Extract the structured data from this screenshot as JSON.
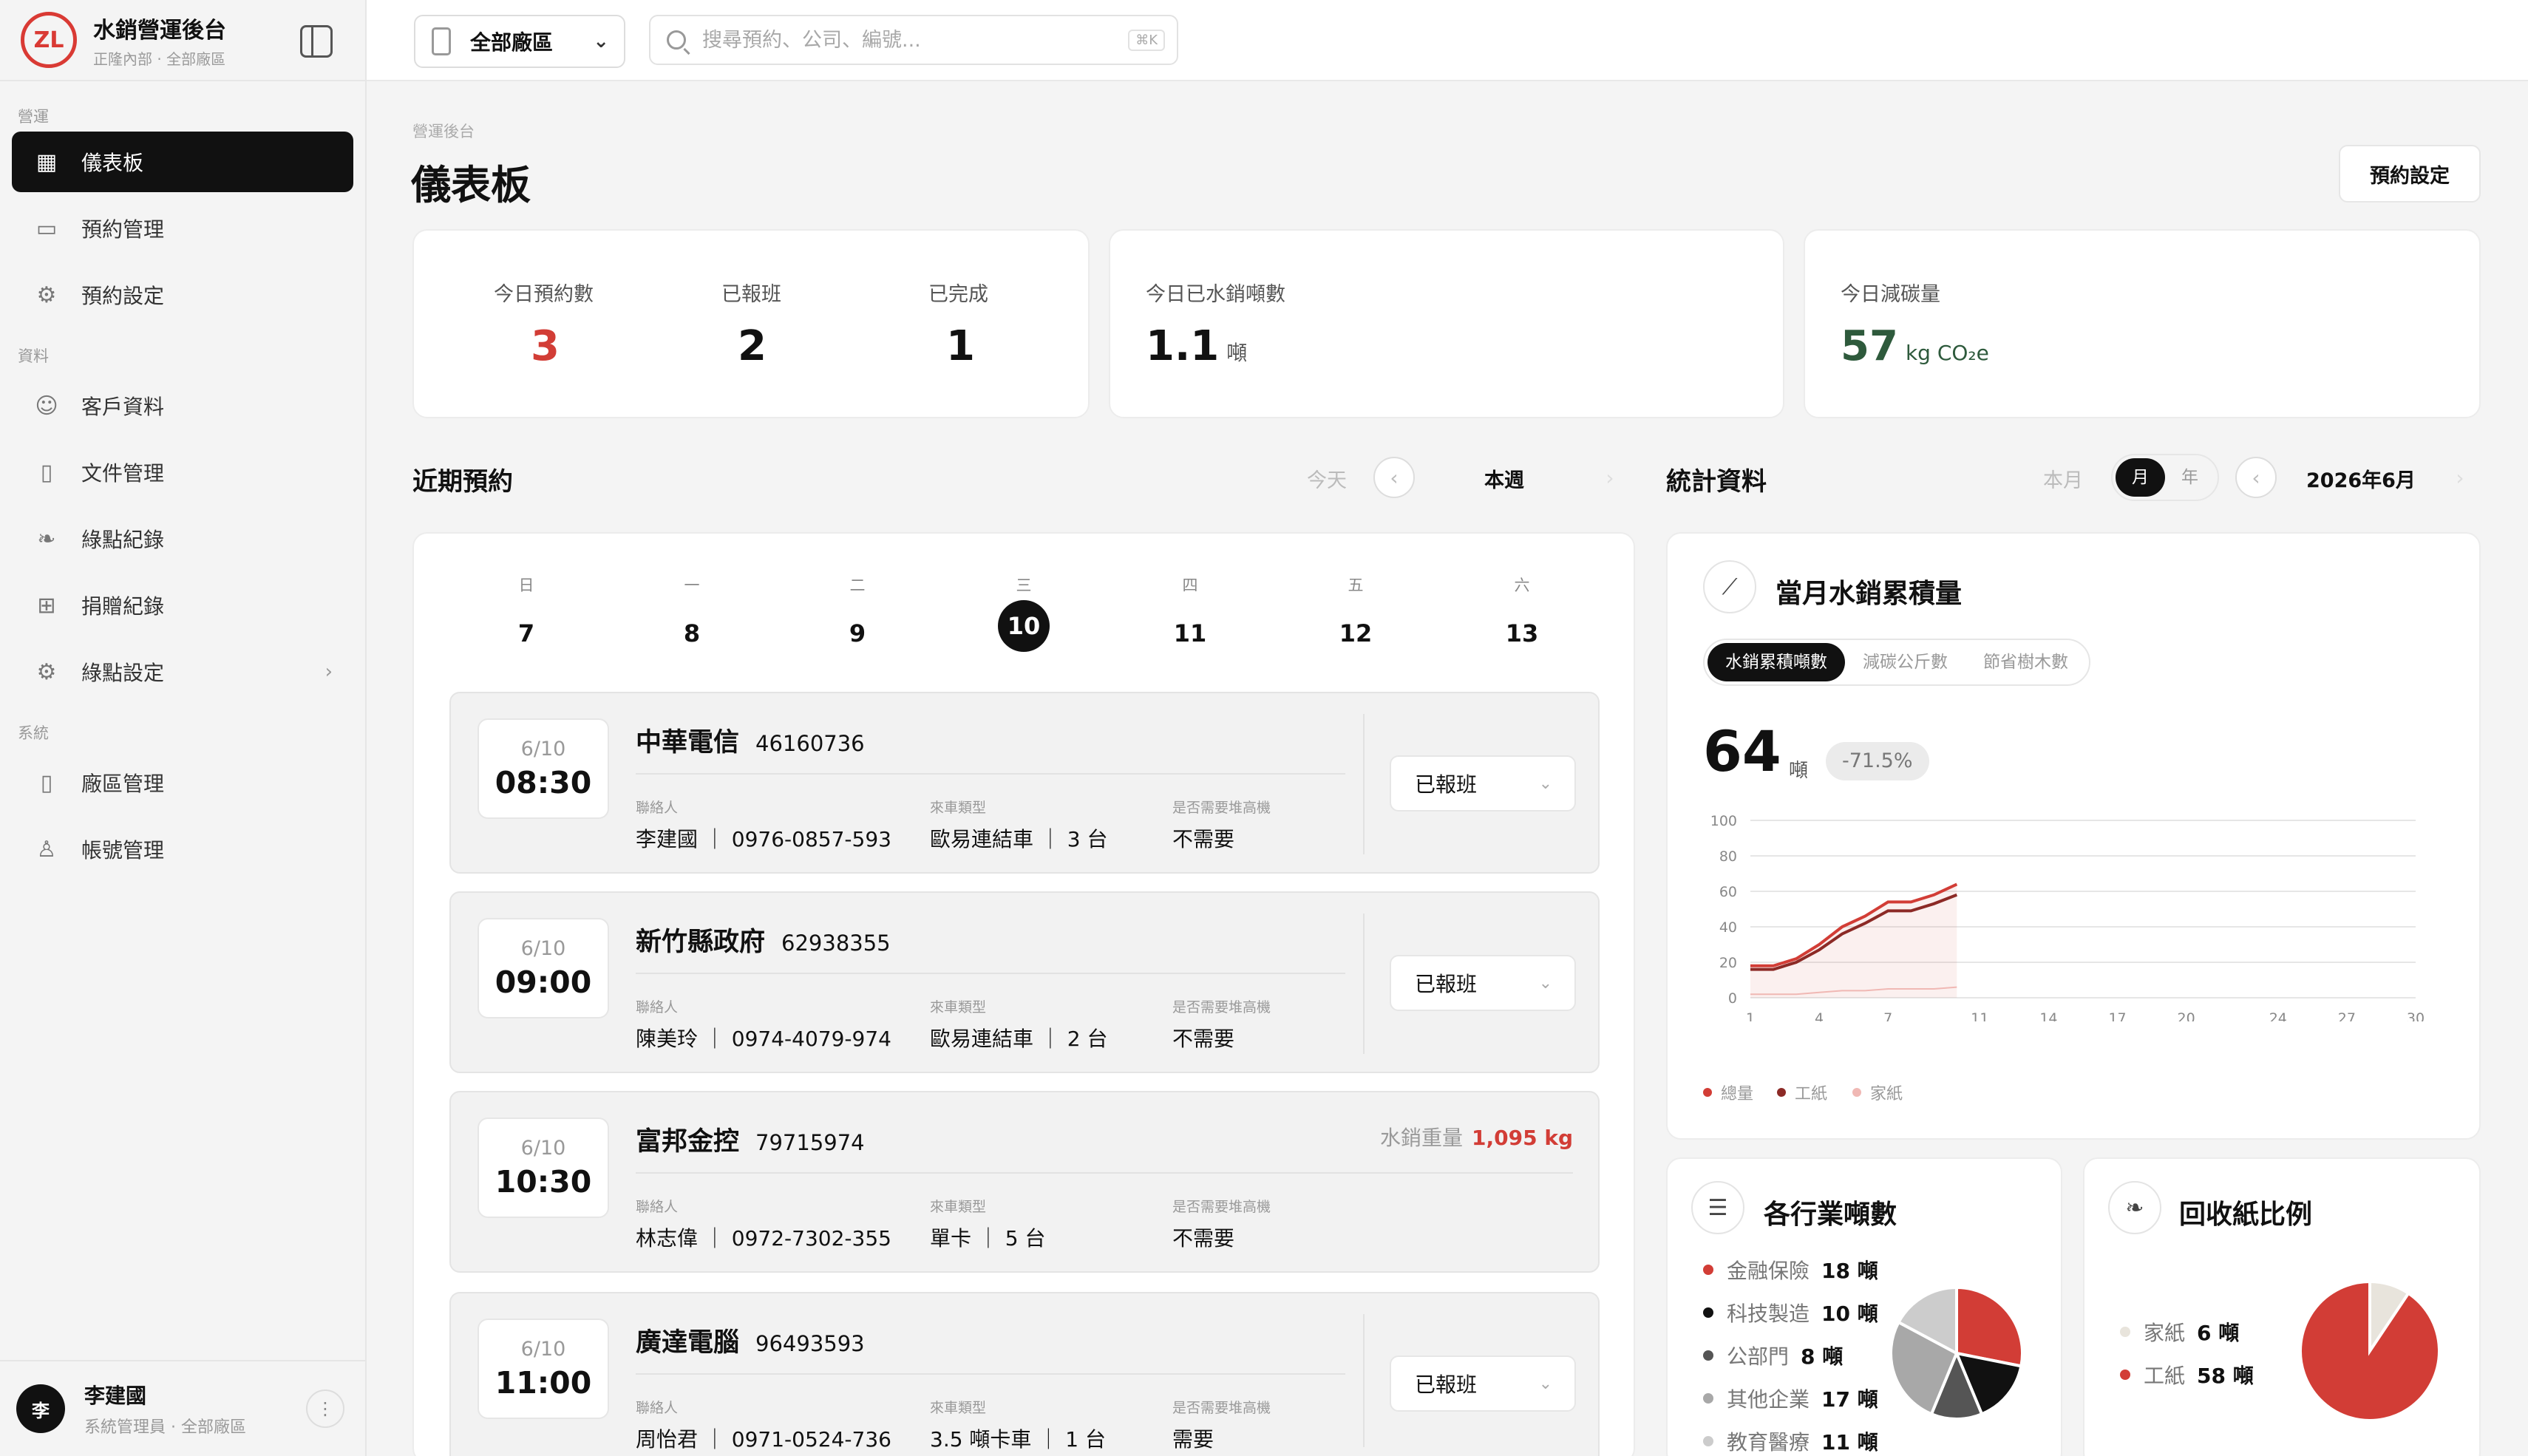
{
  "app": {
    "title": "水銷營運後台",
    "subtitle": "正隆內部 · 全部廠區",
    "logo_text": "ZL"
  },
  "sidebar": {
    "sections": {
      "ops": "營運",
      "data": "資料",
      "system": "系統"
    },
    "items": [
      {
        "label": "儀表板",
        "icon": "grid-icon",
        "active": true
      },
      {
        "label": "預約管理",
        "icon": "calendar-icon"
      },
      {
        "label": "預約設定",
        "icon": "gear-icon"
      },
      {
        "label": "客戶資料",
        "icon": "users-icon"
      },
      {
        "label": "文件管理",
        "icon": "document-icon"
      },
      {
        "label": "綠點紀錄",
        "icon": "leaf-icon"
      },
      {
        "label": "捐贈紀錄",
        "icon": "gift-icon"
      },
      {
        "label": "綠點設定",
        "icon": "gear-icon"
      },
      {
        "label": "廠區管理",
        "icon": "device-icon"
      },
      {
        "label": "帳號管理",
        "icon": "user-icon"
      }
    ],
    "user": {
      "avatar": "李",
      "name": "李建國",
      "role": "系統管理員 · 全部廠區"
    }
  },
  "topbar": {
    "factory_select": "全部廠區",
    "search_placeholder": "搜尋預約、公司、編號...",
    "search_shortcut": "⌘K"
  },
  "page": {
    "breadcrumb": "營運後台",
    "title": "儀表板",
    "settings_button": "預約設定"
  },
  "kpis": {
    "today_reservations": {
      "label": "今日預約數",
      "value": "3",
      "color": "#d23d36"
    },
    "checked_in": {
      "label": "已報班",
      "value": "2"
    },
    "completed": {
      "label": "已完成",
      "value": "1"
    },
    "tons_today": {
      "label": "今日已水銷噸數",
      "value": "1.1",
      "unit": "噸"
    },
    "carbon_today": {
      "label": "今日減碳量",
      "value": "57",
      "unit": "kg CO₂e",
      "color": "#2e5a3c"
    }
  },
  "recent": {
    "title": "近期預約",
    "today_btn": "今天",
    "range_label": "本週",
    "days": [
      {
        "name": "日",
        "num": "7"
      },
      {
        "name": "一",
        "num": "8"
      },
      {
        "name": "二",
        "num": "9"
      },
      {
        "name": "三",
        "num": "10",
        "selected": true
      },
      {
        "name": "四",
        "num": "11"
      },
      {
        "name": "五",
        "num": "12"
      },
      {
        "name": "六",
        "num": "13"
      }
    ],
    "field_labels": {
      "contact": "聯絡人",
      "vehicle": "來車類型",
      "forklift": "是否需要堆高機"
    },
    "weight_label": "水銷重量",
    "appointments": [
      {
        "date": "6/10",
        "time": "08:30",
        "company": "中華電信",
        "tax_id": "46160736",
        "contact": "李建國 ｜ 0976-0857-593",
        "vehicle": "歐易連結車 ｜ 3 台",
        "forklift": "不需要",
        "status": "已報班"
      },
      {
        "date": "6/10",
        "time": "09:00",
        "company": "新竹縣政府",
        "tax_id": "62938355",
        "contact": "陳美玲 ｜ 0974-4079-974",
        "vehicle": "歐易連結車 ｜ 2 台",
        "forklift": "不需要",
        "status": "已報班"
      },
      {
        "date": "6/10",
        "time": "10:30",
        "company": "富邦金控",
        "tax_id": "79715974",
        "contact": "林志偉 ｜ 0972-7302-355",
        "vehicle": "單卡 ｜ 5 台",
        "forklift": "不需要",
        "weight": "1,095 kg"
      },
      {
        "date": "6/10",
        "time": "11:00",
        "company": "廣達電腦",
        "tax_id": "96493593",
        "contact": "周怡君 ｜ 0971-0524-736",
        "vehicle": "3.5 噸卡車 ｜ 1 台",
        "forklift": "需要",
        "status": "已報班"
      }
    ]
  },
  "stats": {
    "title": "統計資料",
    "this_month_btn": "本月",
    "toggle": [
      "月",
      "年"
    ],
    "period_label": "2026年6月",
    "monthly": {
      "title": "當月水銷累積量",
      "tabs": [
        "水銷累積噸數",
        "減碳公斤數",
        "節省樹木數"
      ],
      "value": "64",
      "unit": "噸",
      "change": "-71.5%"
    },
    "industry": {
      "title": "各行業噸數",
      "rows": [
        {
          "label": "金融保險",
          "value": "18 噸",
          "color": "#d23d36"
        },
        {
          "label": "科技製造",
          "value": "10 噸",
          "color": "#111111"
        },
        {
          "label": "公部門",
          "value": "8 噸",
          "color": "#555555"
        },
        {
          "label": "其他企業",
          "value": "17 噸",
          "color": "#a8a8a8"
        },
        {
          "label": "教育醫療",
          "value": "11 噸",
          "color": "#cccccc"
        }
      ]
    },
    "paper": {
      "title": "回收紙比例",
      "rows": [
        {
          "label": "家紙",
          "value": "6 噸",
          "color": "#e8e4dc"
        },
        {
          "label": "工紙",
          "value": "58 噸",
          "color": "#d23d36"
        }
      ]
    }
  },
  "chart_data": [
    {
      "type": "line",
      "title": "當月水銷累積量",
      "x_ticks": [
        "1",
        "4",
        "7",
        "11",
        "14",
        "17",
        "20",
        "24",
        "27",
        "30"
      ],
      "y_ticks": [
        "0",
        "20",
        "40",
        "60",
        "80",
        "100"
      ],
      "ylim": [
        0,
        100
      ],
      "xlim": [
        1,
        30
      ],
      "grid": true,
      "legend": "bottom-left",
      "series": [
        {
          "name": "總量",
          "color": "#d23d36",
          "x": [
            1,
            2,
            3,
            4,
            5,
            6,
            7,
            8,
            9,
            10
          ],
          "y": [
            18,
            18,
            22,
            30,
            40,
            46,
            54,
            54,
            58,
            64
          ]
        },
        {
          "name": "工紙",
          "color": "#8c2a26",
          "x": [
            1,
            2,
            3,
            4,
            5,
            6,
            7,
            8,
            9,
            10
          ],
          "y": [
            16,
            16,
            20,
            27,
            36,
            42,
            49,
            49,
            53,
            58
          ]
        },
        {
          "name": "家紙",
          "color": "#f0b8b4",
          "x": [
            1,
            2,
            3,
            4,
            5,
            6,
            7,
            8,
            9,
            10
          ],
          "y": [
            2,
            2,
            2,
            3,
            4,
            4,
            5,
            5,
            5,
            6
          ]
        }
      ]
    },
    {
      "type": "pie",
      "title": "各行業噸數",
      "labels": [
        "金融保險",
        "科技製造",
        "公部門",
        "其他企業",
        "教育醫療"
      ],
      "values": [
        18,
        10,
        8,
        17,
        11
      ],
      "colors": [
        "#d23d36",
        "#111111",
        "#555555",
        "#a8a8a8",
        "#cccccc"
      ]
    },
    {
      "type": "pie",
      "title": "回收紙比例",
      "labels": [
        "家紙",
        "工紙"
      ],
      "values": [
        6,
        58
      ],
      "colors": [
        "#e8e4dc",
        "#d23d36"
      ]
    }
  ]
}
